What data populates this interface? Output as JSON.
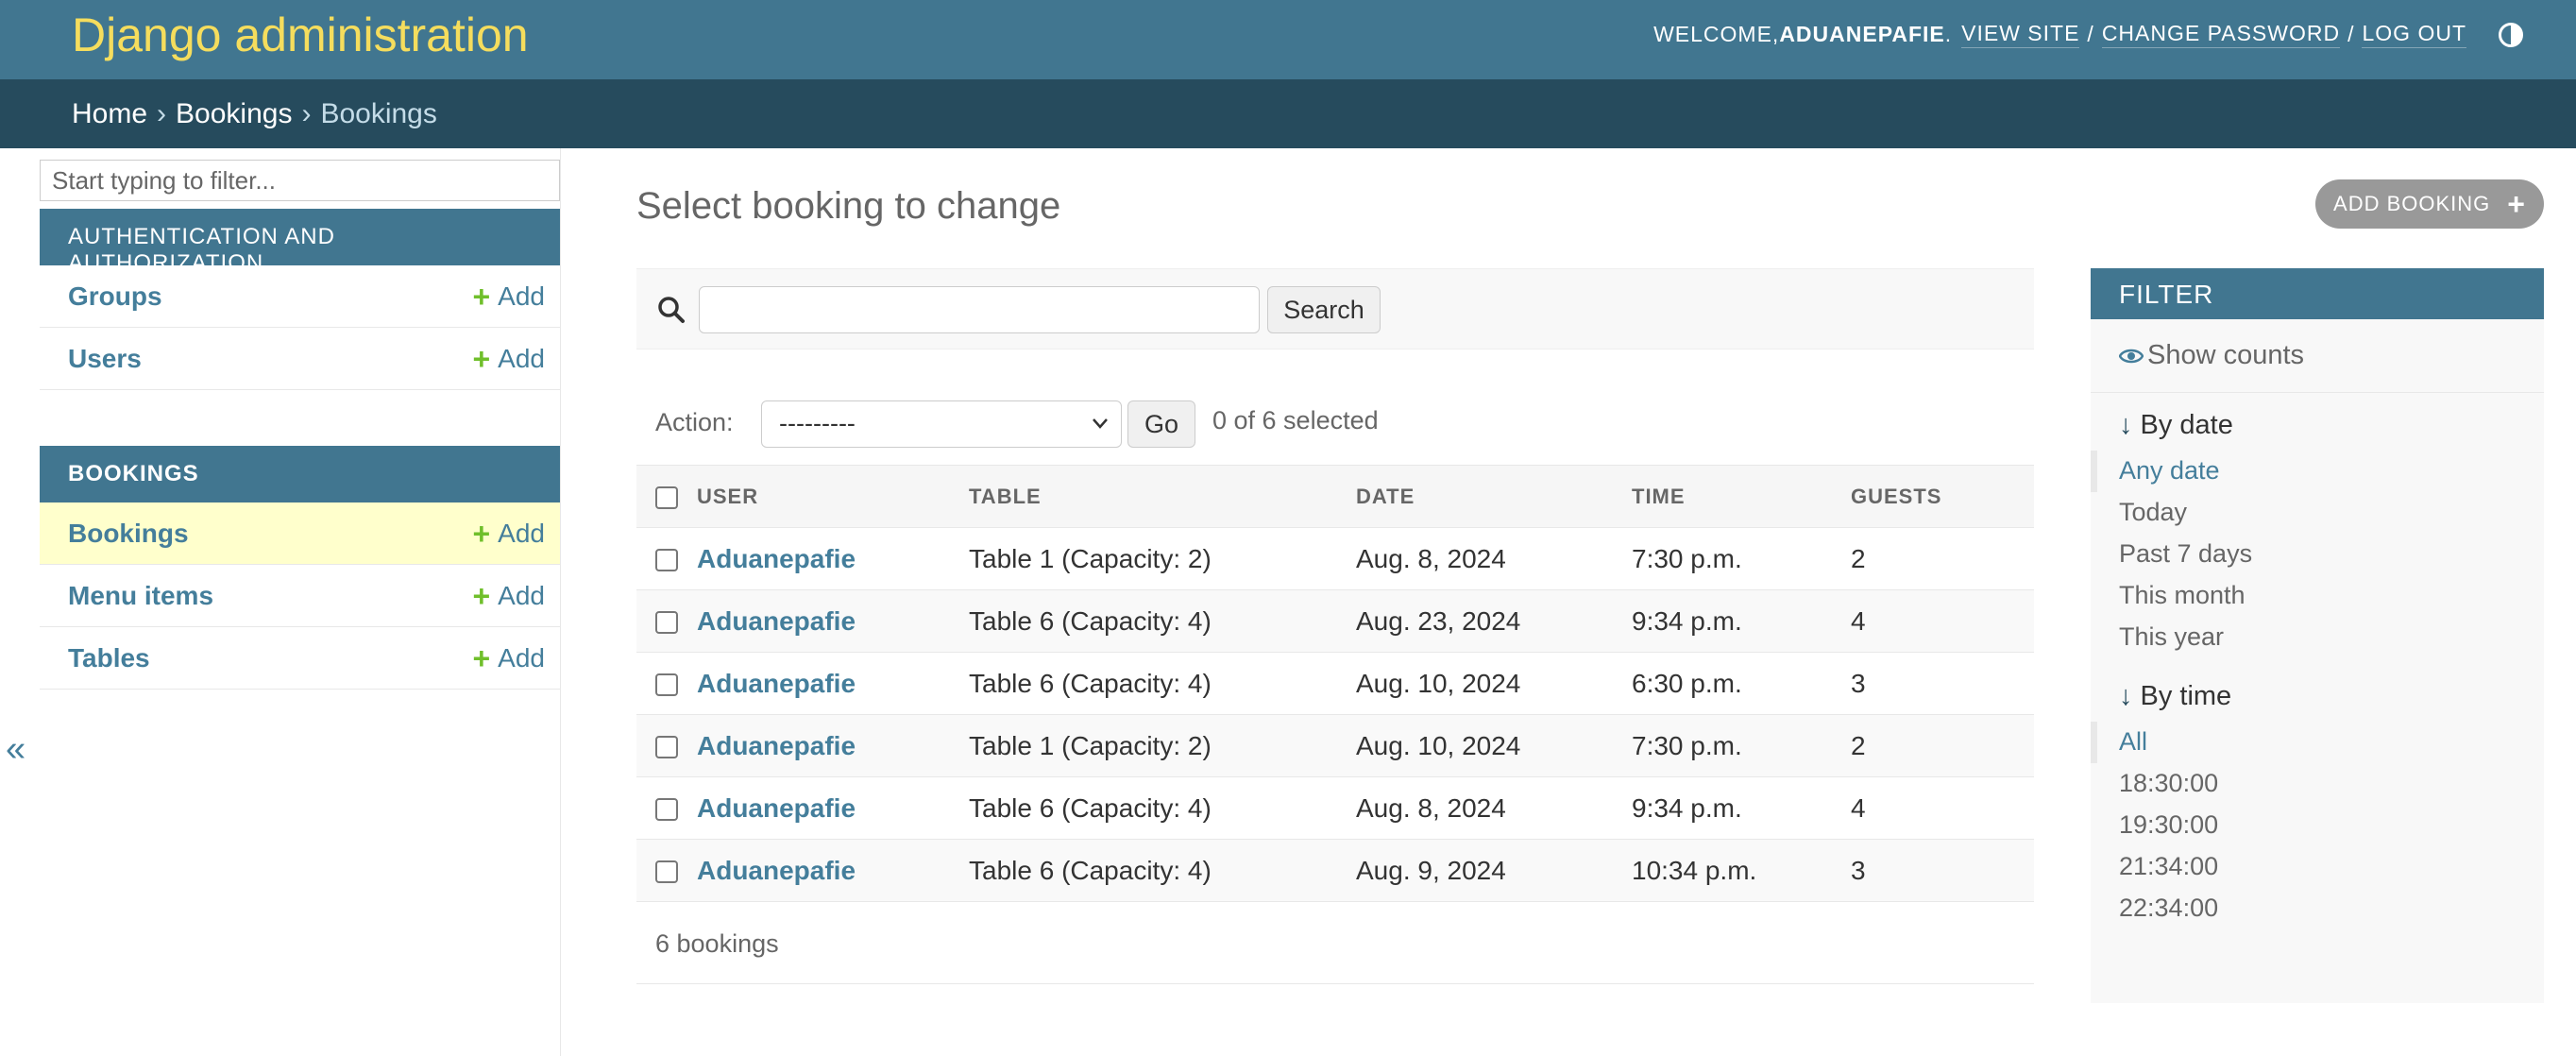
{
  "header": {
    "branding": "Django administration",
    "welcome": "WELCOME, ",
    "username": "ADUANEPAFIE",
    "period": ".",
    "view_site": "VIEW SITE",
    "change_password": "CHANGE PASSWORD",
    "log_out": "LOG OUT",
    "separator": "/"
  },
  "breadcrumbs": {
    "home": "Home",
    "app": "Bookings",
    "current": "Bookings",
    "sep": "›"
  },
  "sidebar": {
    "filter_placeholder": "Start typing to filter...",
    "collapse_icon": "«",
    "add_label": "Add",
    "modules": [
      {
        "caption": "Authentication and Authorization",
        "models": [
          "Groups",
          "Users"
        ]
      },
      {
        "caption": "Bookings",
        "models": [
          "Bookings",
          "Menu items",
          "Tables"
        ]
      }
    ]
  },
  "content": {
    "title": "Select booking to change",
    "add_button": "ADD BOOKING",
    "search_button": "Search",
    "search_value": "",
    "action_label": "Action:",
    "action_selected": "---------",
    "go_button": "Go",
    "selection_counter": "0 of 6 selected",
    "columns": [
      "User",
      "Table",
      "Date",
      "Time",
      "Guests"
    ],
    "rows": [
      {
        "user": "Aduanepafie",
        "table": "Table 1 (Capacity: 2)",
        "date": "Aug. 8, 2024",
        "time": "7:30 p.m.",
        "guests": "2"
      },
      {
        "user": "Aduanepafie",
        "table": "Table 6 (Capacity: 4)",
        "date": "Aug. 23, 2024",
        "time": "9:34 p.m.",
        "guests": "4"
      },
      {
        "user": "Aduanepafie",
        "table": "Table 6 (Capacity: 4)",
        "date": "Aug. 10, 2024",
        "time": "6:30 p.m.",
        "guests": "3"
      },
      {
        "user": "Aduanepafie",
        "table": "Table 1 (Capacity: 2)",
        "date": "Aug. 10, 2024",
        "time": "7:30 p.m.",
        "guests": "2"
      },
      {
        "user": "Aduanepafie",
        "table": "Table 6 (Capacity: 4)",
        "date": "Aug. 8, 2024",
        "time": "9:34 p.m.",
        "guests": "4"
      },
      {
        "user": "Aduanepafie",
        "table": "Table 6 (Capacity: 4)",
        "date": "Aug. 9, 2024",
        "time": "10:34 p.m.",
        "guests": "3"
      }
    ],
    "paginator": "6 bookings"
  },
  "filter": {
    "heading": "FILTER",
    "show_counts": "Show counts",
    "by_date_title": "By date",
    "by_date_options": [
      "Any date",
      "Today",
      "Past 7 days",
      "This month",
      "This year"
    ],
    "by_time_title": "By time",
    "by_time_options": [
      "All",
      "18:30:00",
      "19:30:00",
      "21:34:00",
      "22:34:00"
    ]
  },
  "colors": {
    "header_bg": "#417690",
    "breadcrumb_bg": "#264b5d",
    "branding": "#f5dd5d",
    "link": "#447e9b",
    "add_plus": "#70bf2b",
    "current_row": "#ffffcc"
  },
  "icons": [
    "search-icon",
    "eye-icon",
    "arrow-down-icon",
    "plus-icon",
    "theme-toggle-icon",
    "chevron-down-icon",
    "collapse-icon"
  ]
}
